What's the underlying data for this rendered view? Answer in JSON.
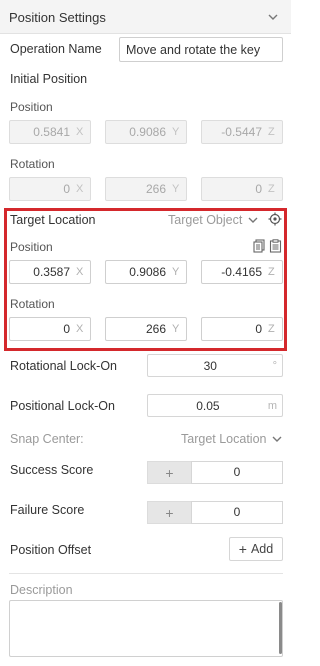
{
  "panel": {
    "title": "Position Settings"
  },
  "operation": {
    "label": "Operation Name",
    "value": "Move and rotate the key"
  },
  "initial": {
    "heading": "Initial Position",
    "position_label": "Position",
    "position": {
      "x": "0.5841",
      "y": "0.9086",
      "z": "-0.5447"
    },
    "rotation_label": "Rotation",
    "rotation": {
      "x": "0",
      "y": "266",
      "z": "0"
    }
  },
  "target": {
    "label": "Target Location",
    "mode": "Target Object",
    "position_label": "Position",
    "position": {
      "x": "0.3587",
      "y": "0.9086",
      "z": "-0.4165"
    },
    "rotation_label": "Rotation",
    "rotation": {
      "x": "0",
      "y": "266",
      "z": "0"
    }
  },
  "axes": {
    "x": "X",
    "y": "Y",
    "z": "Z"
  },
  "rot_lock": {
    "label": "Rotational Lock-On",
    "value": "30",
    "unit": "°"
  },
  "pos_lock": {
    "label": "Positional Lock-On",
    "value": "0.05",
    "unit": "m"
  },
  "snap": {
    "label": "Snap Center:",
    "value": "Target Location"
  },
  "success": {
    "label": "Success Score",
    "plus": "+",
    "value": "0"
  },
  "failure": {
    "label": "Failure Score",
    "plus": "+",
    "value": "0"
  },
  "offset": {
    "label": "Position Offset",
    "add_plus": "+",
    "add_label": "Add"
  },
  "description": {
    "label": "Description",
    "value": ""
  },
  "colors": {
    "highlight": "#d4282c",
    "header_bg": "#f4f4f4"
  }
}
